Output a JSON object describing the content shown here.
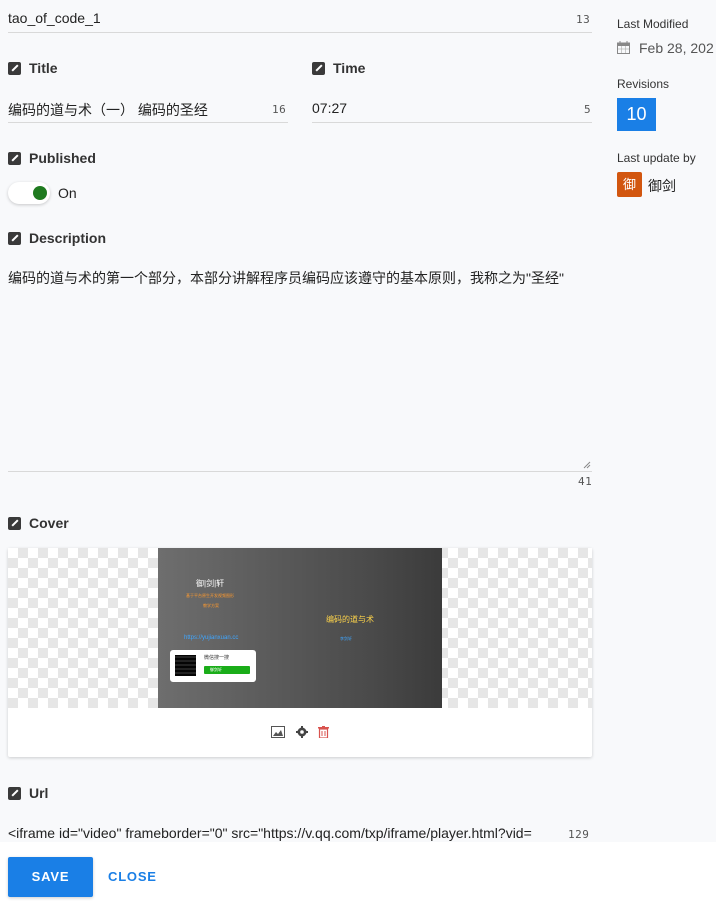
{
  "form": {
    "id_value": "tao_of_code_1",
    "id_count": "13",
    "title_label": "Title",
    "title_value": "编码的道与术（一） 编码的圣经",
    "title_count": "16",
    "time_label": "Time",
    "time_value": "07:27",
    "time_count": "5",
    "published_label": "Published",
    "published_toggle": "On",
    "description_label": "Description",
    "description_value": "编码的道与术的第一个部分，本部分讲解程序员编码应该遵守的基本原则，我称之为\"圣经\"",
    "description_count": "41",
    "cover_label": "Cover",
    "url_label": "Url",
    "url_value": "<iframe id=\"video\" frameborder=\"0\" src=\"https://v.qq.com/txp/iframe/player.html?vid=",
    "url_count": "129"
  },
  "cover_image": {
    "brand": "御|剑|轩",
    "tagline1": "基于平台原生开发视频图形",
    "tagline2": "教学方案",
    "link": "https://yujianxuan.cc",
    "main_title": "编码的道与术",
    "sub": "李剑轩",
    "wechat_label": "微信搜一搜",
    "wechat_search": "御剑轩"
  },
  "sidebar": {
    "last_modified_label": "Last Modified",
    "last_modified_value": "Feb 28, 202",
    "revisions_label": "Revisions",
    "revisions_value": "10",
    "last_update_label": "Last update by",
    "avatar_char": "御",
    "user_name": "御剑"
  },
  "actions": {
    "save_label": "SAVE",
    "close_label": "CLOSE"
  },
  "colors": {
    "primary": "#1a7fe6",
    "toggle_on": "#1f7a1f",
    "avatar_bg": "#d2560f",
    "delete_red": "#d9534f"
  }
}
